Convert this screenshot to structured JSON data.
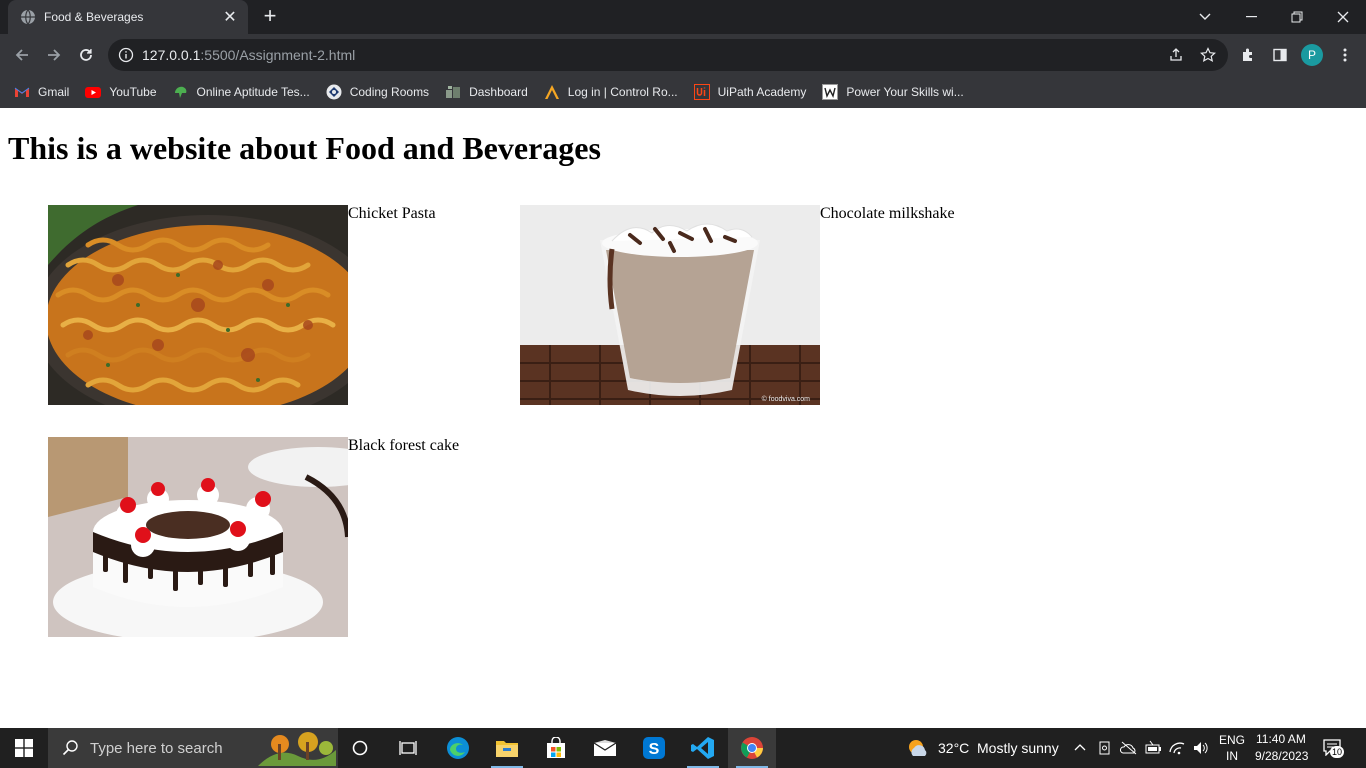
{
  "browser": {
    "tab_title": "Food & Beverages",
    "url_host": "127.0.0.1",
    "url_rest": ":5500/Assignment-2.html",
    "profile_initial": "P",
    "bookmarks": [
      {
        "label": "Gmail",
        "icon": "gmail-icon"
      },
      {
        "label": "YouTube",
        "icon": "youtube-icon"
      },
      {
        "label": "Online Aptitude Tes...",
        "icon": "aptitude-icon"
      },
      {
        "label": "Coding Rooms",
        "icon": "coding-rooms-icon"
      },
      {
        "label": "Dashboard",
        "icon": "dashboard-icon"
      },
      {
        "label": "Log in | Control Ro...",
        "icon": "control-room-icon"
      },
      {
        "label": "UiPath Academy",
        "icon": "uipath-icon"
      },
      {
        "label": "Power Your Skills wi...",
        "icon": "skills-icon"
      }
    ]
  },
  "page": {
    "heading": "This is a website about Food and Beverages",
    "items": [
      {
        "caption": "Chicket Pasta",
        "image": "pasta-image"
      },
      {
        "caption": "Chocolate milkshake",
        "image": "milkshake-image",
        "watermark": "© foodviva.com"
      },
      {
        "caption": "Black forest cake",
        "image": "cake-image"
      }
    ]
  },
  "taskbar": {
    "search_placeholder": "Type here to search",
    "weather_temp": "32°C",
    "weather_text": "Mostly sunny",
    "lang_top": "ENG",
    "lang_bottom": "IN",
    "time": "11:40 AM",
    "date": "9/28/2023",
    "notification_count": "10"
  },
  "colors": {
    "chrome_dark": "#202124",
    "chrome_toolbar": "#35363a",
    "taskbar": "#202020"
  }
}
